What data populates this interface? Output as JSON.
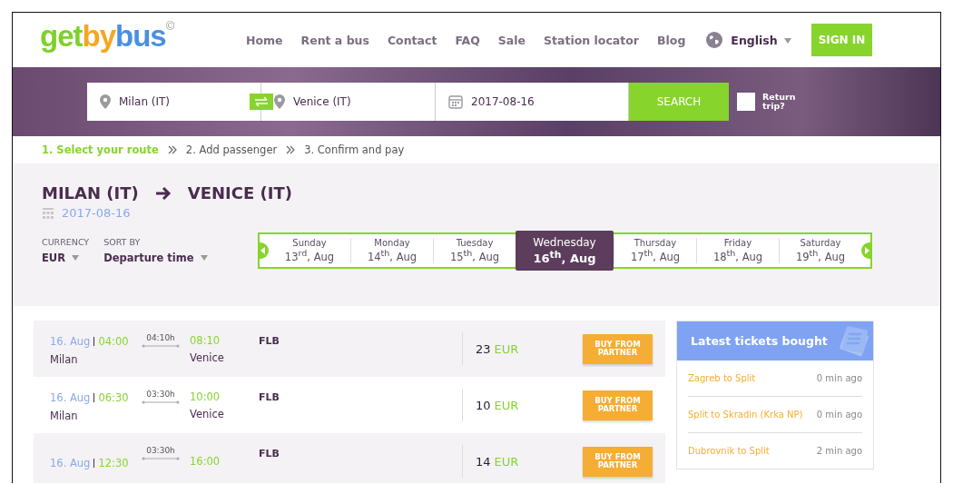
{
  "logo": {
    "parts": [
      {
        "text": "get",
        "color": "#7dd12b"
      },
      {
        "text": "by",
        "color": "#f5a623"
      },
      {
        "text": "bus",
        "color": "#4a90e2"
      }
    ],
    "mark": "©"
  },
  "nav": [
    "Home",
    "Rent a bus",
    "Contact",
    "FAQ",
    "Sale",
    "Station locator",
    "Blog"
  ],
  "language": "English",
  "sign_in": "SIGN IN",
  "search": {
    "from": "Milan (IT)",
    "to": "Venice (IT)",
    "date": "2017-08-16",
    "button": "SEARCH",
    "return_trip": {
      "label": "Return trip?",
      "checked": false
    }
  },
  "steps": [
    {
      "label": "1. Select your route",
      "selected": true
    },
    {
      "label": "2. Add passenger",
      "selected": false
    },
    {
      "label": "3. Confirm and pay",
      "selected": false
    }
  ],
  "route": {
    "from": "MILAN (IT)",
    "to": "VENICE (IT)",
    "date": "2017-08-16"
  },
  "filters": [
    {
      "label": "CURRENCY",
      "value": "EUR"
    },
    {
      "label": "SORT BY",
      "value": "Departure time"
    }
  ],
  "days": [
    {
      "weekday": "Sunday",
      "date": "13$^{rd}$, Aug",
      "selected": false
    },
    {
      "weekday": "Monday",
      "date": "14$^{th}$, Aug",
      "selected": false
    },
    {
      "weekday": "Tuesday",
      "date": "15$^{th}$, Aug",
      "selected": false
    },
    {
      "weekday": "Wednesday",
      "date": "16$^{th}$, Aug",
      "selected": true
    },
    {
      "weekday": "Thursday",
      "date": "17$^{th}$, Aug",
      "selected": false
    },
    {
      "weekday": "Friday",
      "date": "18$^{th}$, Aug",
      "selected": false
    },
    {
      "weekday": "Saturday",
      "date": "19$^{th}$, Aug",
      "selected": false
    }
  ],
  "trips": [
    {
      "date": "16. Aug",
      "depart": "04:00",
      "from": "Milan",
      "duration": "04:10h",
      "arrive": "08:10",
      "to": "Venice",
      "operator": "FLB",
      "price": "23",
      "currency": "EUR",
      "button": "BUY FROM PARTNER"
    },
    {
      "date": "16. Aug",
      "depart": "06:30",
      "from": "Milan",
      "duration": "03:30h",
      "arrive": "10:00",
      "to": "Venice",
      "operator": "FLB",
      "price": "10",
      "currency": "EUR",
      "button": "BUY FROM PARTNER"
    },
    {
      "date": "16. Aug",
      "depart": "12:30",
      "duration": "03:30h",
      "arrive": "16:00",
      "operator": "FLB",
      "price": "14",
      "currency": "EUR",
      "button": "BUY FROM PARTNER"
    }
  ],
  "latest": {
    "title": "Latest tickets bought",
    "items": [
      {
        "route": "Zagreb to Split",
        "time": "0 min ago"
      },
      {
        "route": "Split to Skradin (Krka NP)",
        "time": "0 min ago"
      },
      {
        "route": "Dubrovnik to Split",
        "time": "2 min ago"
      }
    ]
  }
}
